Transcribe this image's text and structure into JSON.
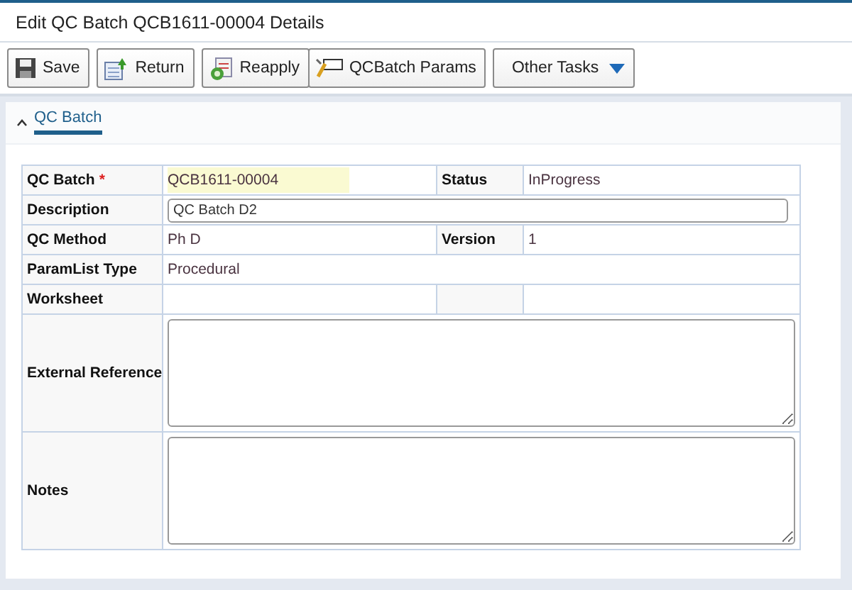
{
  "title": "Edit QC Batch QCB1611-00004 Details",
  "toolbar": [
    [
      {
        "label": "Save",
        "kind": "plain"
      }
    ],
    [
      {
        "label": "Return",
        "kind": "plain"
      }
    ],
    [
      {
        "label": "Reapply",
        "kind": "plain"
      },
      {
        "label": "QCBatch Params",
        "kind": "plain"
      }
    ],
    [
      {
        "label": "Other Tasks",
        "kind": "dropdown"
      }
    ]
  ],
  "tab": {
    "label": "QC Batch",
    "expanded": true,
    "selected": true
  },
  "rows": [
    {
      "kind": "pair",
      "label": "QC Batch",
      "required_mark": "*",
      "value": "QCB1611-00004",
      "highlighted": true,
      "label2": "Status",
      "value2": "InProgress"
    },
    {
      "kind": "input",
      "label": "Description",
      "value": "QC Batch D2"
    },
    {
      "kind": "pair",
      "label": "QC Method",
      "value": "Ph D",
      "label2": "Version",
      "value2": "1"
    },
    {
      "kind": "static",
      "label": "ParamList Type",
      "value": "Procedural"
    },
    {
      "kind": "pair",
      "label": "Worksheet"
    },
    {
      "kind": "textarea",
      "label": "External Reference"
    },
    {
      "kind": "textarea",
      "label": "Notes"
    }
  ]
}
